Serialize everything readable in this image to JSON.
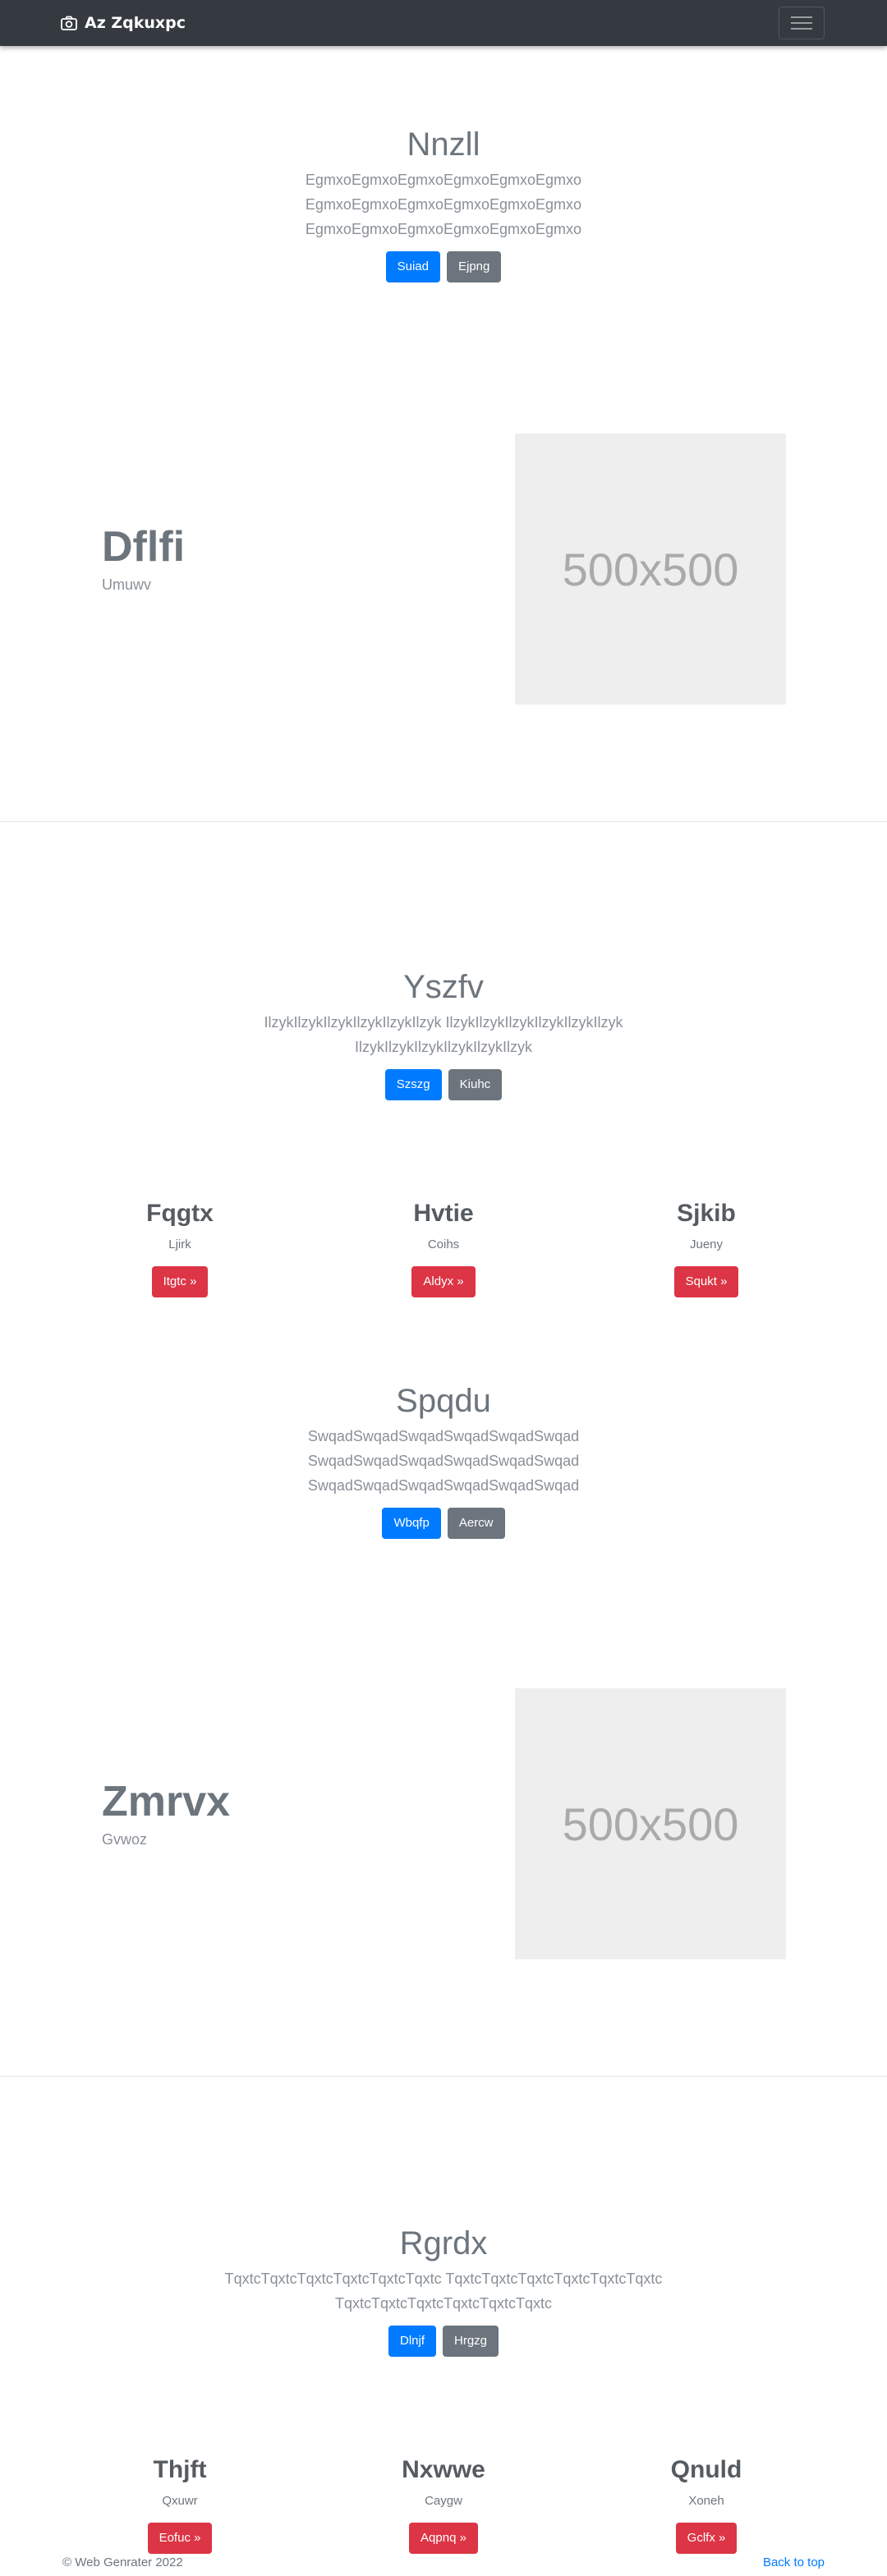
{
  "navbar": {
    "brand": "Az Zqkuxpc",
    "brand_icon": "camera-icon",
    "toggler_icon": "hamburger-menu-icon"
  },
  "hero1": {
    "title": "Nnzll",
    "lines": [
      "EgmxoEgmxoEgmxoEgmxoEgmxoEgmxo",
      "EgmxoEgmxoEgmxoEgmxoEgmxoEgmxo",
      "EgmxoEgmxoEgmxoEgmxoEgmxoEgmxo"
    ],
    "primary": "Suiad",
    "secondary": "Ejpng"
  },
  "feature1": {
    "title": "Dflfi",
    "subtitle": "Umuwv",
    "image_text": "500x500"
  },
  "hero2": {
    "title": "Yszfv",
    "lines": [
      "IlzykIlzykIlzykIlzykIlzykIlzyk IlzykIlzykIlzykIlzykIlzykIlzyk",
      "IlzykIlzykIlzykIlzykIlzykIlzyk"
    ],
    "primary": "Szszg",
    "secondary": "Kiuhc"
  },
  "cols1": [
    {
      "title": "Fqgtx",
      "subtitle": "Ljirk",
      "button": "Itgtc »"
    },
    {
      "title": "Hvtie",
      "subtitle": "Coihs",
      "button": "Aldyx »"
    },
    {
      "title": "Sjkib",
      "subtitle": "Jueny",
      "button": "Squkt »"
    }
  ],
  "hero3": {
    "title": "Spqdu",
    "lines": [
      "SwqadSwqadSwqadSwqadSwqadSwqad",
      "SwqadSwqadSwqadSwqadSwqadSwqad",
      "SwqadSwqadSwqadSwqadSwqadSwqad"
    ],
    "primary": "Wbqfp",
    "secondary": "Aercw"
  },
  "feature2": {
    "title": "Zmrvx",
    "subtitle": "Gvwoz",
    "image_text": "500x500"
  },
  "hero4": {
    "title": "Rgrdx",
    "lines": [
      "TqxtcTqxtcTqxtcTqxtcTqxtcTqxtc TqxtcTqxtcTqxtcTqxtcTqxtcTqxtc",
      "TqxtcTqxtcTqxtcTqxtcTqxtcTqxtc"
    ],
    "primary": "Dlnjf",
    "secondary": "Hrgzg"
  },
  "cols2": [
    {
      "title": "Thjft",
      "subtitle": "Qxuwr",
      "button": "Eofuc »"
    },
    {
      "title": "Nxwwe",
      "subtitle": "Caygw",
      "button": "Aqpnq »"
    },
    {
      "title": "Qnuld",
      "subtitle": "Xoneh",
      "button": "Gclfx »"
    }
  ],
  "footer": {
    "copyright": "© Web Genrater 2022",
    "back_to_top": "Back to top"
  },
  "colors": {
    "primary": "#007bff",
    "secondary": "#6c757d",
    "danger": "#dc3545",
    "navbar": "#343a40"
  }
}
